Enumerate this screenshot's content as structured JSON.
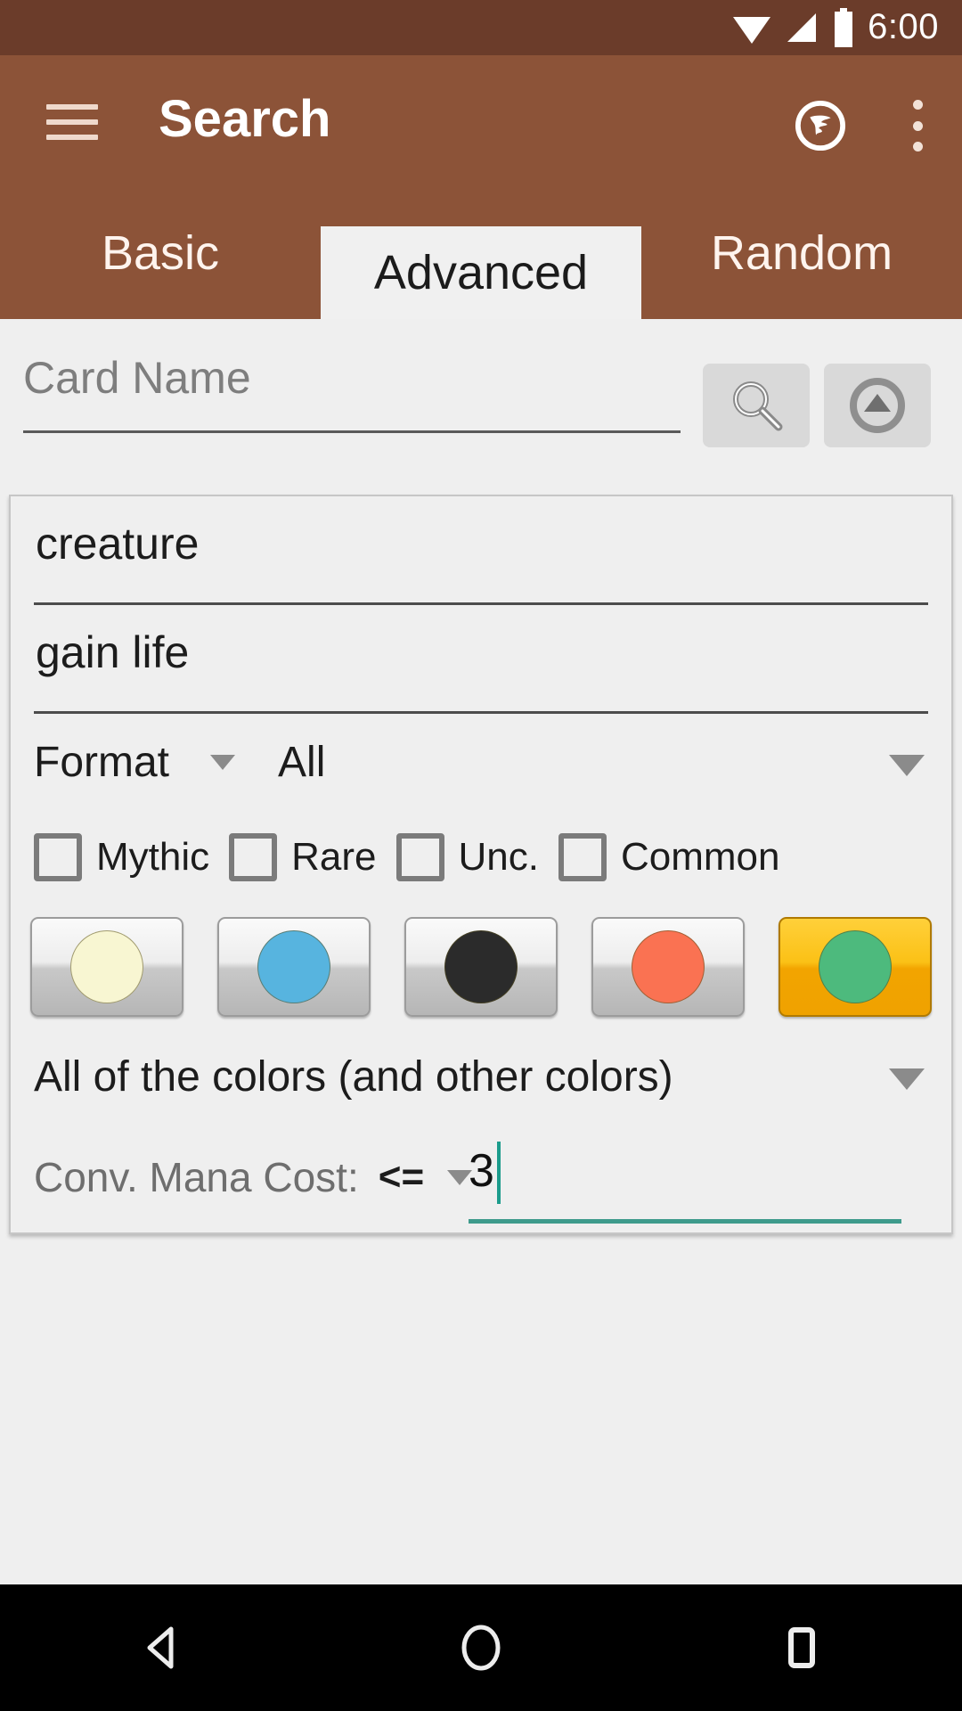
{
  "statusbar": {
    "time": "6:00",
    "icons": [
      "wifi-icon",
      "signal-icon",
      "battery-icon"
    ]
  },
  "appbar": {
    "title": "Search",
    "menu_icon": "hamburger-menu-icon",
    "logo_icon": "app-logo-icon",
    "overflow_icon": "overflow-menu-icon"
  },
  "tabs": [
    {
      "label": "Basic",
      "active": false
    },
    {
      "label": "Advanced",
      "active": true
    },
    {
      "label": "Random",
      "active": false
    }
  ],
  "search_row": {
    "card_name_placeholder": "Card Name",
    "card_name_value": "",
    "search_icon": "magnifier-icon",
    "collapse_icon": "collapse-up-icon"
  },
  "panel": {
    "type_field": {
      "value": "creature",
      "placeholder": ""
    },
    "text_field": {
      "value": "gain life",
      "placeholder": ""
    },
    "format": {
      "label": "Format",
      "value": "All",
      "caret_icon": "chevron-down-icon"
    },
    "rarity": [
      {
        "label": "Mythic",
        "checked": false
      },
      {
        "label": "Rare",
        "checked": false
      },
      {
        "label": "Unc.",
        "checked": false
      },
      {
        "label": "Common",
        "checked": false
      }
    ],
    "mana_colors": [
      {
        "name": "white",
        "hex": "#F8F6D2",
        "selected": false
      },
      {
        "name": "blue",
        "hex": "#57B4DF",
        "selected": false
      },
      {
        "name": "black",
        "hex": "#2B2B2B",
        "selected": false
      },
      {
        "name": "red",
        "hex": "#FA7252",
        "selected": false
      },
      {
        "name": "green",
        "hex": "#4DBA7D",
        "selected": true
      }
    ],
    "color_match": {
      "value": "All of the colors (and other colors)",
      "caret_icon": "chevron-down-icon"
    },
    "cmc": {
      "label": "Conv. Mana Cost:",
      "operator": "<=",
      "value": "3",
      "caret_icon": "chevron-down-icon"
    }
  },
  "navbar": {
    "back": "back-nav-icon",
    "home": "home-nav-icon",
    "recents": "recents-nav-icon"
  },
  "theme": {
    "status_bar": "#6B3C2A",
    "app_bar": "#8C5338",
    "active_tab_bg": "#F0F0F0",
    "page_bg": "#EFEFEF",
    "accent_teal": "#3E9B8C",
    "selected_button": "#F2A400"
  }
}
